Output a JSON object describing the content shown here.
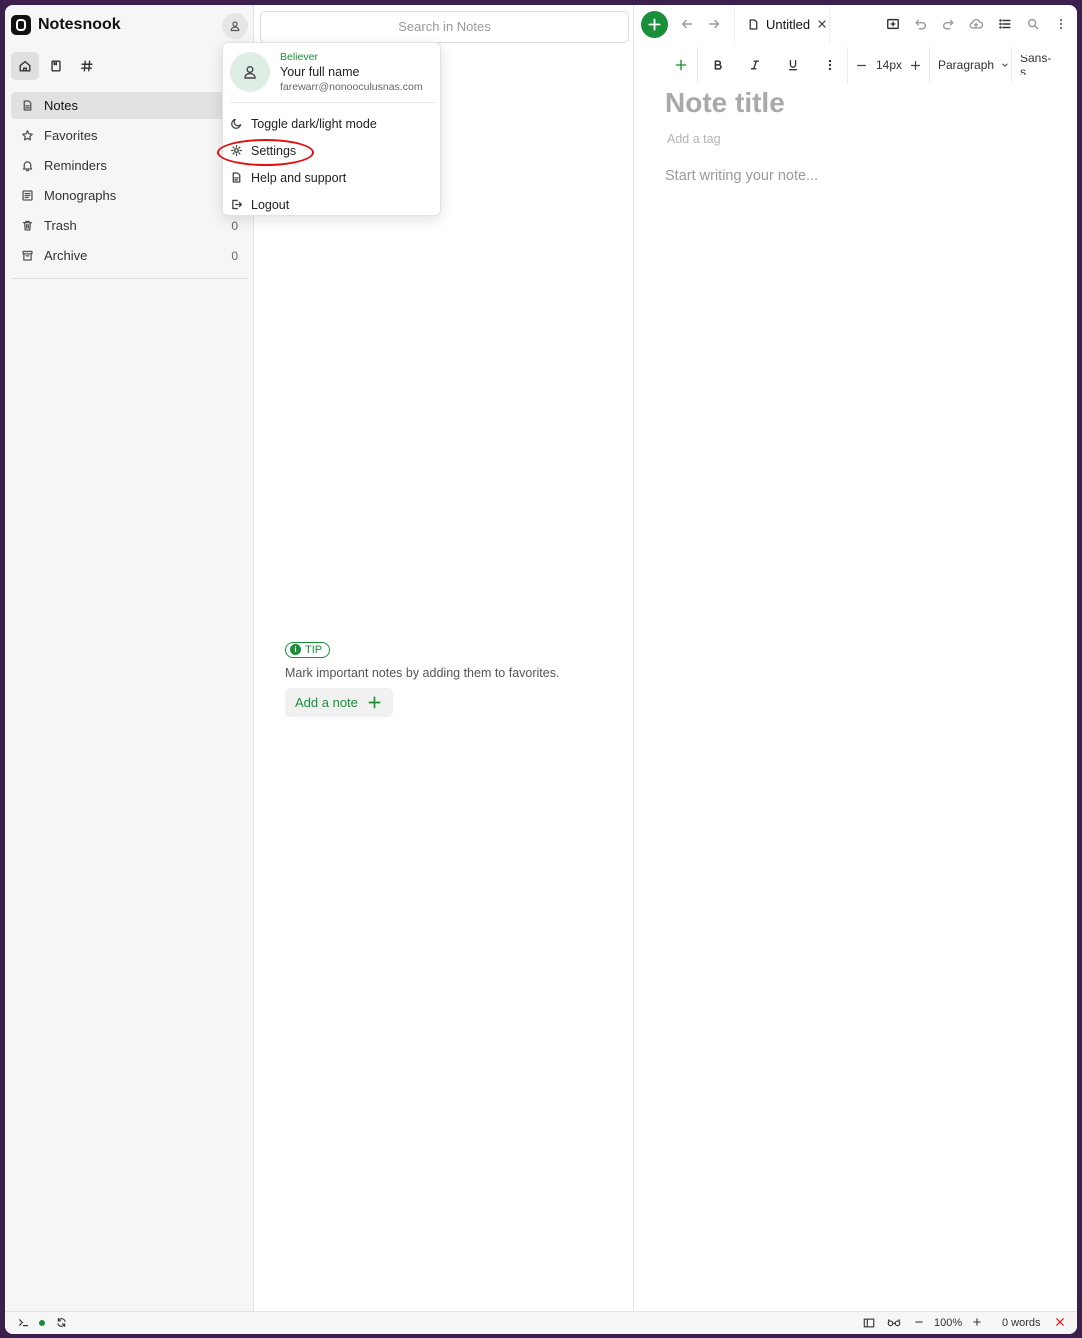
{
  "app": {
    "name": "Notesnook"
  },
  "sidebar": {
    "items": [
      {
        "label": "Notes",
        "count": "",
        "icon": "note-icon"
      },
      {
        "label": "Favorites",
        "count": "",
        "icon": "star-icon"
      },
      {
        "label": "Reminders",
        "count": "",
        "icon": "bell-icon"
      },
      {
        "label": "Monographs",
        "count": "",
        "icon": "monograph-icon"
      },
      {
        "label": "Trash",
        "count": "0",
        "icon": "trash-icon"
      },
      {
        "label": "Archive",
        "count": "0",
        "icon": "archive-icon"
      }
    ]
  },
  "list": {
    "search_placeholder": "Search in Notes",
    "tip_badge": "TIP",
    "tip_text": "Mark important notes by adding them to favorites.",
    "add_note_label": "Add a note"
  },
  "profile_menu": {
    "plan": "Believer",
    "name": "Your full name",
    "email": "farewarr@nonooculusnas.com",
    "items": [
      {
        "label": "Toggle dark/light mode",
        "icon": "moon-icon"
      },
      {
        "label": "Settings",
        "icon": "gear-icon"
      },
      {
        "label": "Help and support",
        "icon": "help-doc-icon"
      },
      {
        "label": "Logout",
        "icon": "logout-icon"
      }
    ]
  },
  "editor": {
    "tab_title": "Untitled",
    "font_size": "14px",
    "block_type": "Paragraph",
    "font_family": "Sans-s",
    "title_placeholder": "Note title",
    "tag_placeholder": "Add a tag",
    "body_placeholder": "Start writing your note..."
  },
  "status": {
    "zoom": "100%",
    "word_count": "0 words"
  },
  "colors": {
    "accent": "#1a8f3a",
    "highlight": "#e01010",
    "background": "#3b1f4d"
  }
}
